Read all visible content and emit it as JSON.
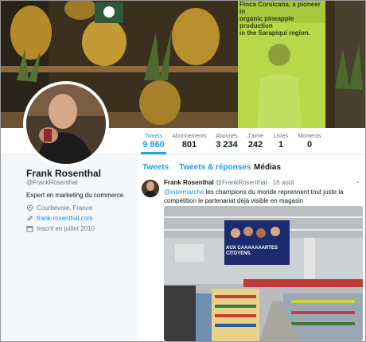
{
  "banner": {
    "sign_lines": [
      "Finca Corsicana, a pioneer in",
      "organic pineapple production",
      "in the Sarapiquí region."
    ]
  },
  "stats": [
    {
      "label": "Tweets",
      "value": "9 860",
      "active": true
    },
    {
      "label": "Abonnements",
      "value": "801"
    },
    {
      "label": "Abonnés",
      "value": "3 234"
    },
    {
      "label": "J'aime",
      "value": "242"
    },
    {
      "label": "Listes",
      "value": "1"
    },
    {
      "label": "Moments",
      "value": "0"
    }
  ],
  "profile": {
    "name": "Frank Rosenthal",
    "handle": "@FrankRosenthal",
    "bio": "Expert en marketing du commerce",
    "location": "Courbevoie, France",
    "website": "frank-rosenthal.com",
    "joined": "Inscrit en juillet 2010"
  },
  "tabs": [
    "Tweets",
    "Tweets & réponses",
    "Médias"
  ],
  "tweet": {
    "name": "Frank Rosenthal",
    "handle_time": "@FrankRosenthal · 16 août",
    "mention": "@intermarche",
    "text": " les champions du monde reprennent tout juste la compétition le partenariat déjà visible en magasin",
    "media_sign_line1": "AUX CAAAAAAARTES",
    "media_sign_line2": "CITOYENS."
  },
  "colors": {
    "accent": "#1da1f2",
    "link": "#1b95e0",
    "muted": "#657786"
  }
}
